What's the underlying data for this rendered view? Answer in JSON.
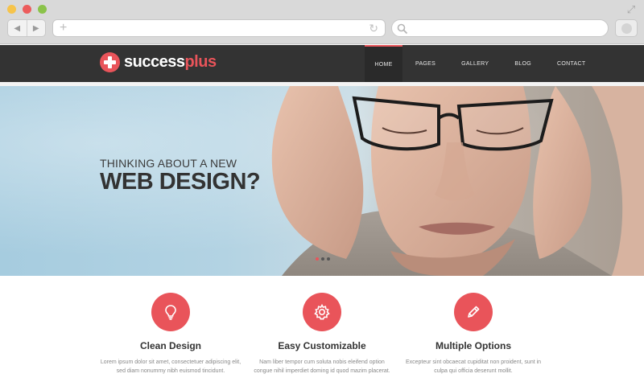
{
  "site": {
    "logo": {
      "part1": "success",
      "part2": "plus"
    },
    "nav": [
      "HOME",
      "PAGES",
      "GALLERY",
      "BLOG",
      "CONTACT"
    ]
  },
  "hero": {
    "kicker": "THINKING ABOUT A NEW",
    "title": "WEB DESIGN?"
  },
  "features": [
    {
      "title": "Clean Design",
      "line1": "Lorem ipsum dolor sit amet, consectetuer adipiscing elit,",
      "line2": "sed diam nonummy nibh euismod tincidunt."
    },
    {
      "title": "Easy Customizable",
      "line1": "Nam liber tempor cum soluta nobis eleifend option",
      "line2": "congue nihil imperdiet doming id quod mazim placerat."
    },
    {
      "title": "Multiple Options",
      "line1": "Excepteur sint obcaecat cupiditat non proident, sunt in",
      "line2": "culpa qui officia deserunt mollit."
    }
  ],
  "colors": {
    "accent": "#e9545a",
    "header_bg": "#333333"
  },
  "icons": {
    "feature1": "lightbulb-icon",
    "feature2": "gear-icon",
    "feature3": "pencil-icon"
  }
}
